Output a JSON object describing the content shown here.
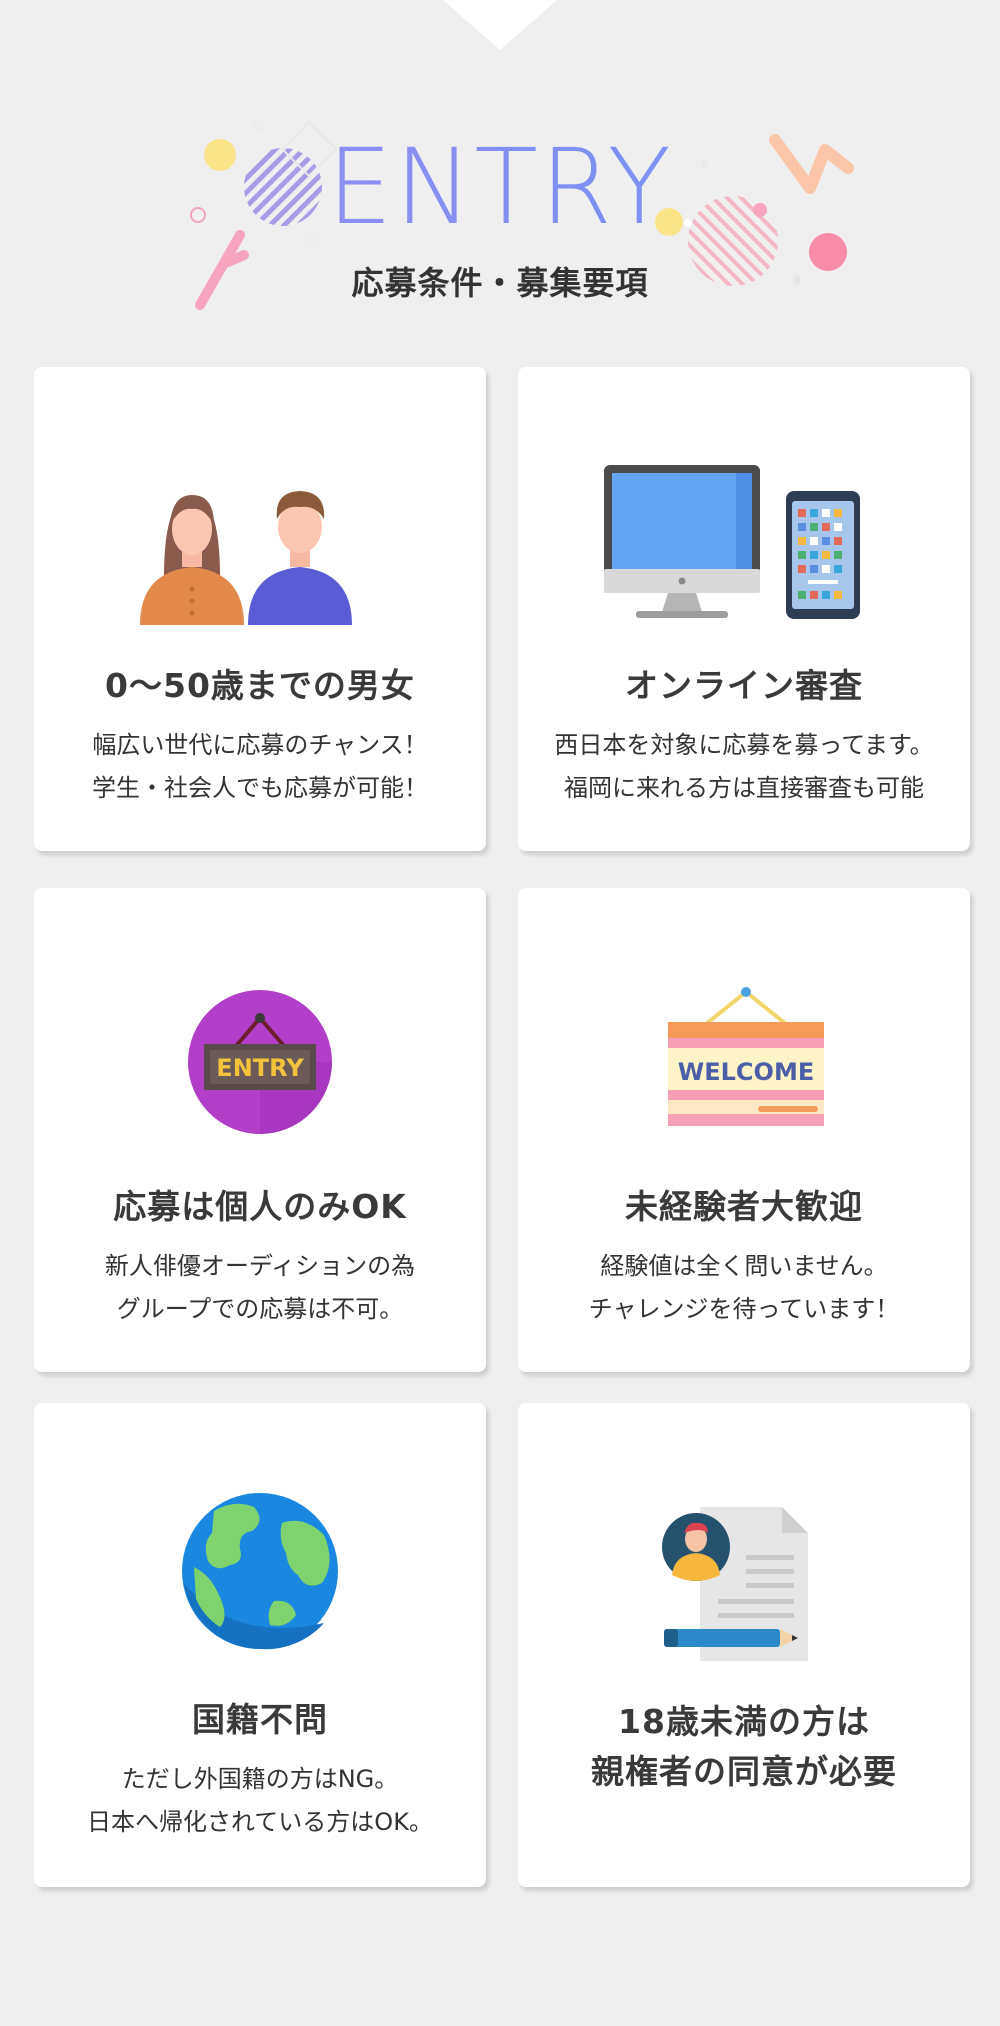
{
  "header": {
    "title": "ENTRY",
    "subtitle": "応募条件・募集要項"
  },
  "cards": [
    {
      "icon": "couple-icon",
      "title": "0〜50歳までの男女",
      "lines": [
        "幅広い世代に応募のチャンス！",
        "学生・社会人でも応募が可能！"
      ]
    },
    {
      "icon": "devices-icon",
      "title": "オンライン審査",
      "lines": [
        "西日本を対象に応募を募ってます。",
        "福岡に来れる方は直接審査も可能"
      ]
    },
    {
      "icon": "entry-sign-icon",
      "icon_text": "ENTRY",
      "title": "応募は個人のみOK",
      "lines": [
        "新人俳優オーディションの為",
        "グループでの応募は不可。"
      ]
    },
    {
      "icon": "welcome-sign-icon",
      "icon_text": "WELCOME",
      "title": "未経験者大歓迎",
      "lines": [
        "経験値は全く問いません。",
        "チャレンジを待っています！"
      ]
    },
    {
      "icon": "globe-icon",
      "title": "国籍不問",
      "lines": [
        "ただし外国籍の方はNG。",
        "日本へ帰化されている方はOK。"
      ]
    },
    {
      "icon": "consent-document-icon",
      "title_lines": [
        "18歳未満の方は",
        "親権者の同意が必要"
      ]
    }
  ]
}
